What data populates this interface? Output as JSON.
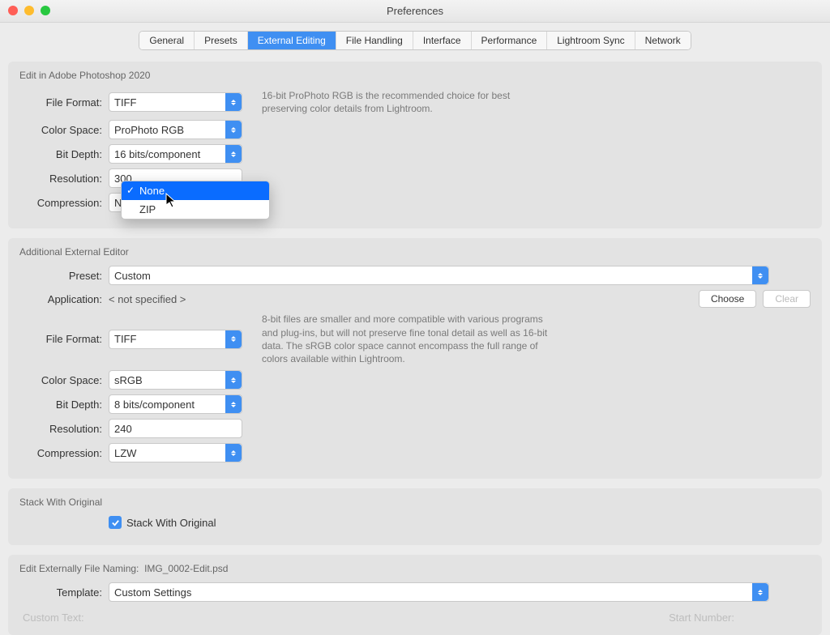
{
  "window": {
    "title": "Preferences"
  },
  "tabs": [
    "General",
    "Presets",
    "External Editing",
    "File Handling",
    "Interface",
    "Performance",
    "Lightroom Sync",
    "Network"
  ],
  "active_tab_index": 2,
  "section1": {
    "title": "Edit in Adobe Photoshop 2020",
    "labels": {
      "file_format": "File Format:",
      "color_space": "Color Space:",
      "bit_depth": "Bit Depth:",
      "resolution": "Resolution:",
      "compression": "Compression:"
    },
    "values": {
      "file_format": "TIFF",
      "color_space": "ProPhoto RGB",
      "bit_depth": "16 bits/component",
      "resolution": "300",
      "compression": "None"
    },
    "hint": "16-bit ProPhoto RGB is the recommended choice for best preserving color details from Lightroom.",
    "compression_menu": {
      "options": [
        "None",
        "ZIP"
      ],
      "selected_index": 0
    }
  },
  "section2": {
    "title": "Additional External Editor",
    "labels": {
      "preset": "Preset:",
      "application": "Application:",
      "file_format": "File Format:",
      "color_space": "Color Space:",
      "bit_depth": "Bit Depth:",
      "resolution": "Resolution:",
      "compression": "Compression:"
    },
    "values": {
      "preset": "Custom",
      "application": "< not specified >",
      "file_format": "TIFF",
      "color_space": "sRGB",
      "bit_depth": "8 bits/component",
      "resolution": "240",
      "compression": "LZW"
    },
    "buttons": {
      "choose": "Choose",
      "clear": "Clear"
    },
    "hint": "8-bit files are smaller and more compatible with various programs and plug-ins, but will not preserve fine tonal detail as well as 16-bit data. The sRGB color space cannot encompass the full range of colors available within Lightroom."
  },
  "section3": {
    "title": "Stack With Original",
    "checkbox_label": "Stack With Original",
    "checked": true
  },
  "section4": {
    "title_prefix": "Edit Externally File Naming:",
    "example": "IMG_0002-Edit.psd",
    "labels": {
      "template": "Template:",
      "custom_text": "Custom Text:",
      "start_number": "Start Number:"
    },
    "values": {
      "template": "Custom Settings"
    }
  }
}
